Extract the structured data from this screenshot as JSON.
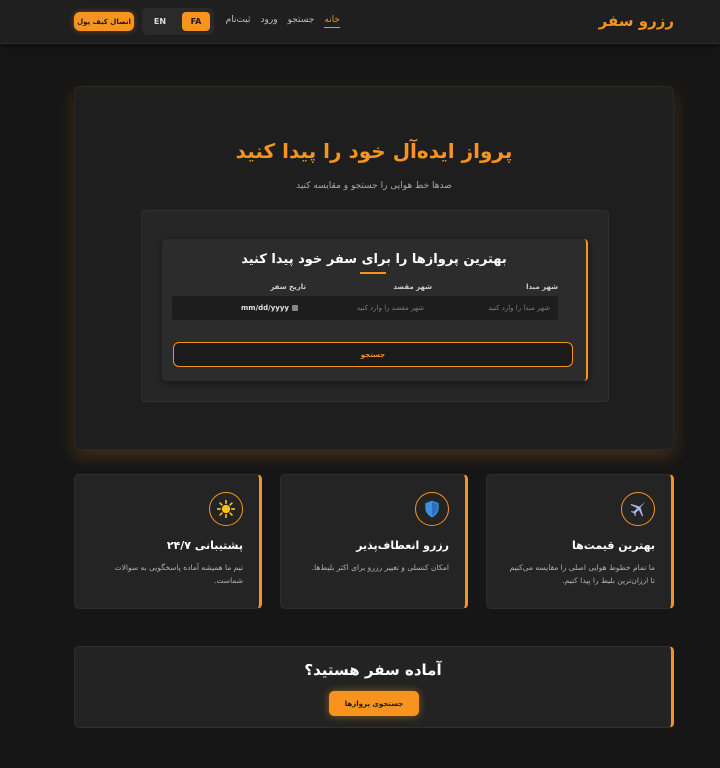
{
  "nav": {
    "brand": "رزرو سفر",
    "links": [
      "خانه",
      "جستجو",
      "ورود",
      "ثبت‌نام"
    ],
    "lang_en": "EN",
    "lang_fa": "FA",
    "wallet": "اتصال کیف پول"
  },
  "hero": {
    "title": "پرواز ایده‌آل خود را پیدا کنید",
    "subtitle": "صدها خط هوایی را جستجو و مقایسه کنید"
  },
  "search": {
    "title": "بهترین پروازها را برای سفر خود پیدا کنید",
    "origin_label": "شهر مبدا",
    "origin_placeholder": "شهر مبدا را وارد کنید",
    "dest_label": "شهر مقصد",
    "dest_placeholder": "شهر مقصد را وارد کنید",
    "date_label": "تاریخ سفر",
    "date_value": "mm/dd/yyyy",
    "button": "جستجو"
  },
  "features": [
    {
      "title": "بهترین قیمت‌ها",
      "desc": "ما تمام خطوط هوایی اصلی را مقایسه می‌کنیم تا ارزان‌ترین بلیط را پیدا کنیم.",
      "icon": "airplane-icon"
    },
    {
      "title": "رزرو انعطاف‌پذیر",
      "desc": "امکان کنسلی و تغییر رزرو برای اکثر بلیط‌ها.",
      "icon": "shield-icon"
    },
    {
      "title": "پشتیبانی ۲۴/۷",
      "desc": "تیم ما همیشه آماده پاسخگویی به سوالات شماست.",
      "icon": "sun-icon"
    }
  ],
  "cta": {
    "title": "آماده سفر هستید؟",
    "button": "جستجوی پروازها"
  },
  "colors": {
    "accent": "#f7931e",
    "background": "#161616",
    "card": "#242424"
  }
}
